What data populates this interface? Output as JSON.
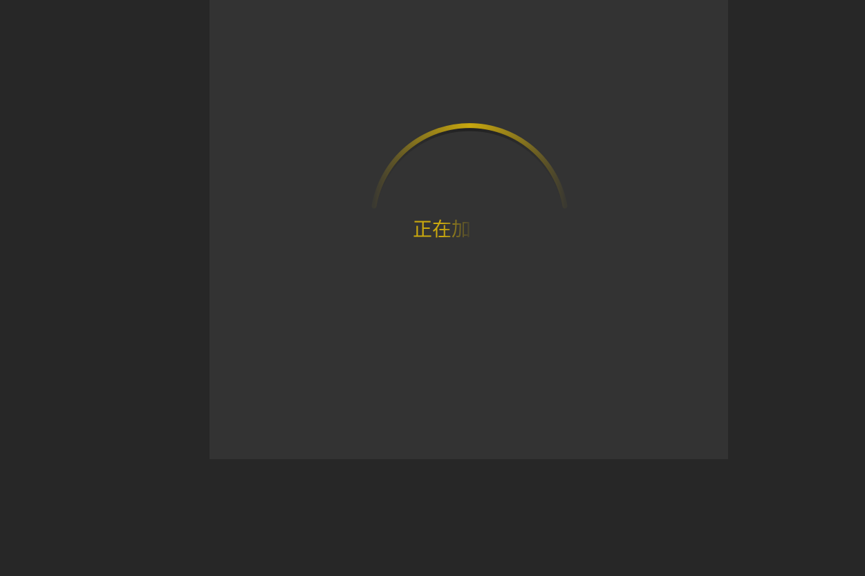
{
  "loader": {
    "text": "正在加",
    "accent_color": "#c9a80e",
    "spinner_icon": "loading-arc-icon"
  },
  "colors": {
    "page_background": "#272727",
    "panel_background": "#333333"
  }
}
